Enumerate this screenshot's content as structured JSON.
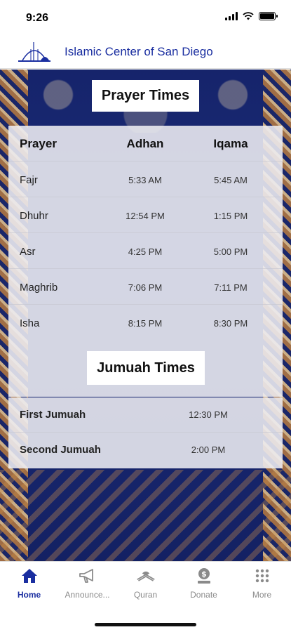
{
  "status_bar": {
    "time": "9:26"
  },
  "header": {
    "title": "Islamic Center of San Diego",
    "logo_icon": "mosque-dome-icon"
  },
  "prayer_section": {
    "title": "Prayer Times",
    "columns": [
      "Prayer",
      "Adhan",
      "Iqama"
    ],
    "rows": [
      {
        "name": "Fajr",
        "adhan": "5:33 AM",
        "iqama": "5:45 AM"
      },
      {
        "name": "Dhuhr",
        "adhan": "12:54 PM",
        "iqama": "1:15 PM"
      },
      {
        "name": "Asr",
        "adhan": "4:25 PM",
        "iqama": "5:00 PM"
      },
      {
        "name": "Maghrib",
        "adhan": "7:06 PM",
        "iqama": "7:11 PM"
      },
      {
        "name": "Isha",
        "adhan": "8:15 PM",
        "iqama": "8:30 PM"
      }
    ]
  },
  "jumuah_section": {
    "title": "Jumuah Times",
    "rows": [
      {
        "name": "First Jumuah",
        "time": "12:30 PM"
      },
      {
        "name": "Second Jumuah",
        "time": "2:00 PM"
      }
    ]
  },
  "tab_bar": {
    "active_color": "#1a2ea0",
    "inactive_color": "#8a8a8a",
    "items": [
      {
        "label": "Home",
        "icon": "home-icon"
      },
      {
        "label": "Announce...",
        "icon": "megaphone-icon"
      },
      {
        "label": "Quran",
        "icon": "quran-book-icon"
      },
      {
        "label": "Donate",
        "icon": "donate-icon"
      },
      {
        "label": "More",
        "icon": "grid-dots-icon"
      }
    ]
  }
}
